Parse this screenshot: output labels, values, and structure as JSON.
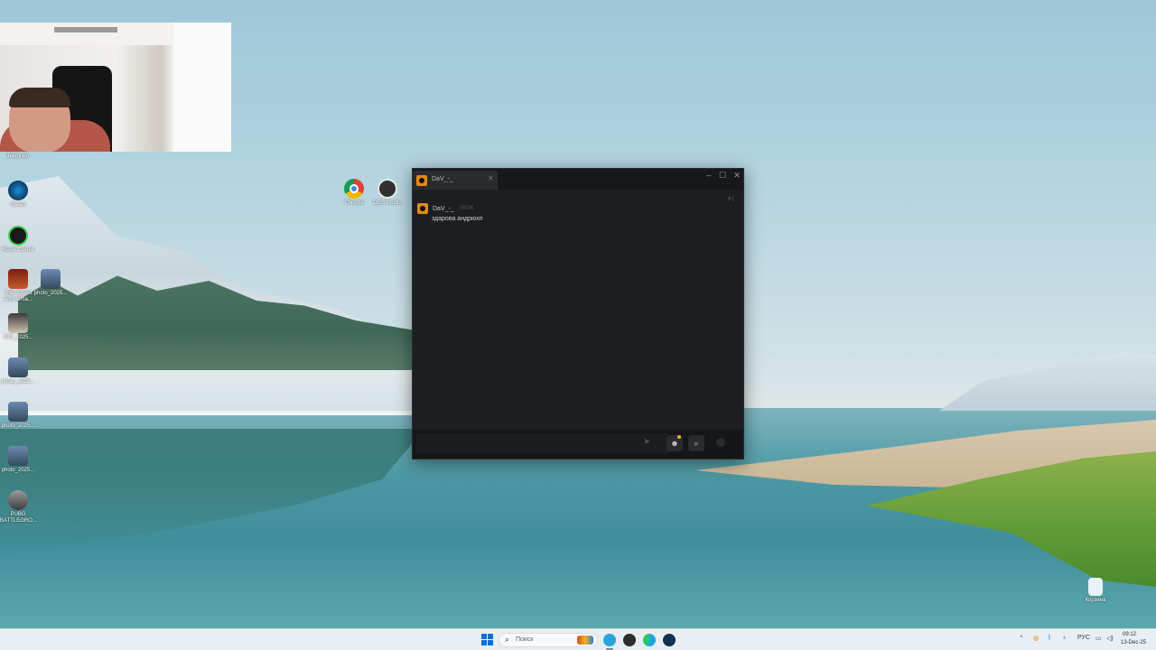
{
  "desktop": {
    "icons": [
      {
        "label": "Telegram"
      },
      {
        "label": "Steam"
      },
      {
        "label": "Razer Cortex"
      },
      {
        "label": "Titan Quest Anniversa..."
      },
      {
        "label": "photo_2025..."
      },
      {
        "label": "IMG_2025..."
      },
      {
        "label": "photo_2025..."
      },
      {
        "label": "photo_2025..."
      },
      {
        "label": "photo_2025..."
      },
      {
        "label": "PUBG BATTLEGRO..."
      },
      {
        "label": "Chrome"
      },
      {
        "label": "OBS Studio"
      },
      {
        "label": "Корзина"
      }
    ]
  },
  "chat": {
    "tab_name": "DaV_-_",
    "messages": [
      {
        "author": "DaV_-_",
        "time": "09:04",
        "text": "здарова андрюхп"
      }
    ],
    "input_placeholder": ""
  },
  "taskbar": {
    "search_placeholder": "Поиск",
    "lang": "РУС",
    "time": "09:12",
    "date": "13-Dec-25"
  },
  "colors": {
    "accent": "#e08a1a",
    "chat_bg": "#1d1e21",
    "taskbar_bg": "#e8eef2"
  }
}
